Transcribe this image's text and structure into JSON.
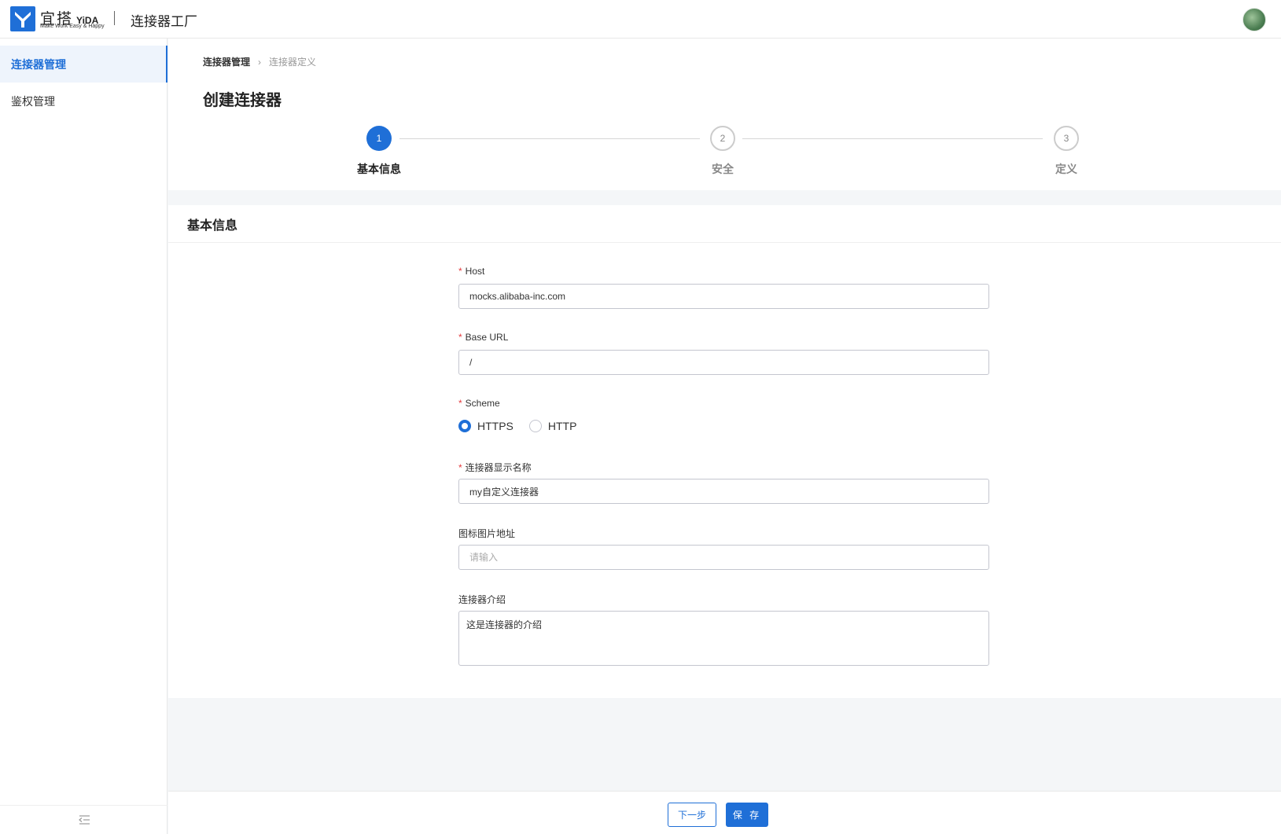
{
  "header": {
    "logo_cn": "宜搭",
    "logo_en": "YiDA",
    "logo_slogan": "Make Work Easy & Happy",
    "app_title": "连接器工厂",
    "avatar_icon": "user-avatar"
  },
  "sidebar": {
    "items": [
      {
        "label": "连接器管理",
        "active": true
      },
      {
        "label": "鉴权管理",
        "active": false
      }
    ],
    "collapse_icon": "collapse-menu-icon"
  },
  "breadcrumb": {
    "home": "连接器管理",
    "current": "连接器定义"
  },
  "page_title": "创建连接器",
  "steps": [
    {
      "number": "1",
      "label": "基本信息",
      "state": "active"
    },
    {
      "number": "2",
      "label": "安全",
      "state": "idle"
    },
    {
      "number": "3",
      "label": "定义",
      "state": "idle"
    }
  ],
  "form": {
    "section_title": "基本信息",
    "host": {
      "label": "Host",
      "value": "mocks.alibaba-inc.com",
      "required": true
    },
    "base_url": {
      "label": "Base URL",
      "value": "/",
      "required": true
    },
    "scheme": {
      "label": "Scheme",
      "required": true,
      "options": [
        "HTTPS",
        "HTTP"
      ],
      "selected": "HTTPS"
    },
    "display_name": {
      "label": "连接器显示名称",
      "value": "my自定义连接器",
      "required": true
    },
    "icon_url": {
      "label": "图标图片地址",
      "value": "",
      "placeholder": "请输入",
      "required": false
    },
    "description": {
      "label": "连接器介绍",
      "value": "这是连接器的介绍",
      "required": false
    }
  },
  "footer": {
    "next_label": "下一步",
    "save_label": "保 存"
  },
  "colors": {
    "primary": "#1f6fd7",
    "required": "#e4393c",
    "page_bg": "#f4f6f8"
  }
}
